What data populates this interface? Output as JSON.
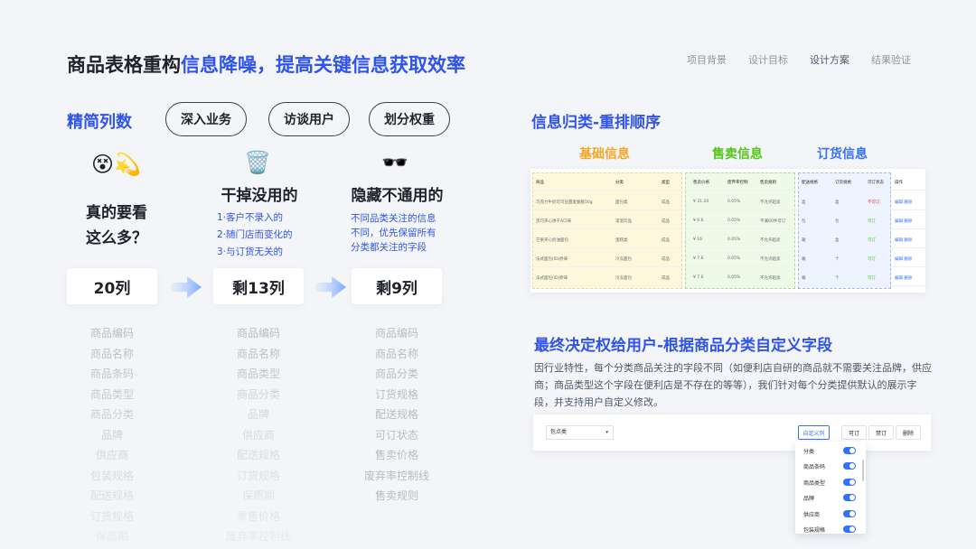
{
  "header": {
    "title_prefix": "商品表格重构",
    "title_highlight": "信息降噪，提高关键信息获取效率",
    "nav": [
      "项目背景",
      "设计目标",
      "设计方案",
      "结果验证"
    ]
  },
  "left": {
    "heading": "精简列数",
    "pills": [
      "深入业务",
      "访谈用户",
      "划分权重"
    ],
    "col1": {
      "emoji": "😵💫",
      "title_line1": "真的要看",
      "title_line2": "这么多？",
      "count": "20列",
      "items": [
        "商品编码",
        "商品名称",
        "商品条码",
        "商品类型",
        "商品分类",
        "品牌",
        "供应商",
        "包装规格",
        "配送规格",
        "订货规格",
        "保质期"
      ]
    },
    "col2": {
      "emoji": "🗑️",
      "title": "干掉没用的",
      "desc": [
        "1·客户不录入的",
        "2·随门店而变化的",
        "3·与订货无关的"
      ],
      "count": "剩13列",
      "items": [
        "商品编码",
        "商品名称",
        "商品类型",
        "商品分类",
        "品牌",
        "供应商",
        "配送规格",
        "订货规格",
        "保质期",
        "零售价格",
        "废弃率控制线"
      ]
    },
    "col3": {
      "emoji": "🕶️",
      "title": "隐藏不通用的",
      "desc": [
        "不同品类关注的信息",
        "不同，优先保留所有",
        "分类都关注的字段"
      ],
      "count": "剩9列",
      "items": [
        "商品编码",
        "商品名称",
        "商品分类",
        "订货规格",
        "配送规格",
        "可订状态",
        "售卖价格",
        "废弃率控制线",
        "售卖规则"
      ]
    }
  },
  "right": {
    "section1_title": "信息归类-重排顺序",
    "categories": [
      "基础信息",
      "售卖信息",
      "订货信息"
    ],
    "colors": {
      "basic": "#f5a623",
      "sale": "#52c41a",
      "order": "#3370ff"
    },
    "table": {
      "headers": [
        "商品",
        "分类",
        "类型",
        "售卖价格",
        "废弃率控制",
        "售卖规则",
        "配送规格",
        "订货规格",
        "可订状态",
        "操作"
      ],
      "rows": [
        [
          "巧克力牛奶可可豆甜麦脆脆50g",
          "面包类",
          "成品",
          "¥ 31.20",
          "0.05%",
          "不允许超卖",
          "盒",
          "盒",
          "不可订",
          "编辑 删除"
        ],
        [
          "黑巧夹心饼干A口味",
          "常温饮品",
          "成品",
          "¥ 6.6",
          "0.05%",
          "不满60件可订",
          "包",
          "包",
          "可订",
          "编辑 删除"
        ],
        [
          "芒果夹心奶油面包",
          "蛋糕类",
          "成品",
          "¥ 16",
          "0.05%",
          "不允许超卖",
          "箱",
          "盒",
          "可订",
          "编辑 删除"
        ],
        [
          "法式面包(ID)原味",
          "冷冻面包",
          "成品",
          "¥ 7.6",
          "0.05%",
          "不允许超卖",
          "箱",
          "个",
          "可订",
          "编辑 删除"
        ],
        [
          "法式面包(ID)原味",
          "冷冻面包",
          "成品",
          "¥ 7.6",
          "0.05%",
          "不允许超卖",
          "箱",
          "个",
          "可订",
          "编辑 删除"
        ]
      ]
    },
    "section2_title": "最终决定权给用户-根据商品分类自定义字段",
    "paragraph": "因行业特性，每个分类商品关注的字段不同（如便利店自研的商品就不需要关注品牌，供应商；商品类型这个字段在便利店是不存在的等等），我们针对每个分类提供默认的展示字段，并支持用户自定义修改。",
    "config": {
      "select_value": "包点类",
      "custom_btn": "自定义列",
      "buttons": [
        "可订",
        "禁订",
        "删除"
      ],
      "dropdown_items": [
        "分类",
        "商品条码",
        "商品类型",
        "品牌",
        "供应商",
        "包装规格"
      ]
    }
  }
}
